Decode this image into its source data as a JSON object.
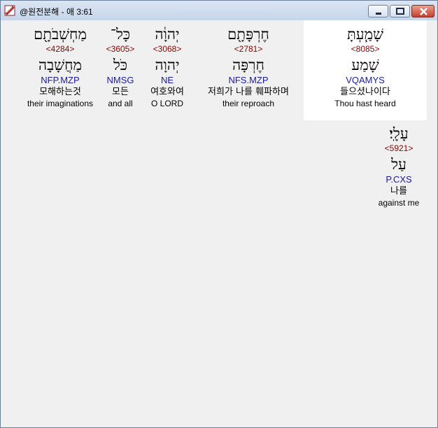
{
  "window": {
    "title": "@원전분해 - 애 3:61",
    "icon": "diagonal-book-icon",
    "controls": {
      "minimize": "minimize-icon",
      "maximize": "maximize-icon",
      "close": "close-icon"
    }
  },
  "words": [
    {
      "heb": "שָׁמַ֧עְתָּ",
      "strong": "<8085>",
      "lemma": "שָׁמַע",
      "morph": "VQAMYS",
      "korean": "들으셨나이다",
      "english": "Thou hast heard"
    },
    {
      "heb": "חֶרְפָּתָ֖ם",
      "strong": "<2781>",
      "lemma": "חֶרְפָּה",
      "morph": "NFS.MZP",
      "korean": "저희가 나를 훼파하며",
      "english": "their reproach"
    },
    {
      "heb": "יְהוָ֔ה",
      "strong": "<3068>",
      "lemma": "יְהוָה",
      "morph": "NE",
      "korean": "여호와여",
      "english": "O LORD"
    },
    {
      "heb": "כָּל־",
      "strong": "<3605>",
      "lemma": "כֹּל",
      "morph": "NMSG",
      "korean": "모든",
      "english": "and all"
    },
    {
      "heb": "מַחְשְׁבֹתָ֖ם",
      "strong": "<4284>",
      "lemma": "מַחֲשָׁבָה",
      "morph": "NFP.MZP",
      "korean": "모해하는것",
      "english": "their imaginations"
    },
    {
      "heb": "עָלָֽי׃",
      "strong": "<5921>",
      "lemma": "עַל",
      "morph": "P.CXS",
      "korean": "나를",
      "english": "against me"
    }
  ]
}
